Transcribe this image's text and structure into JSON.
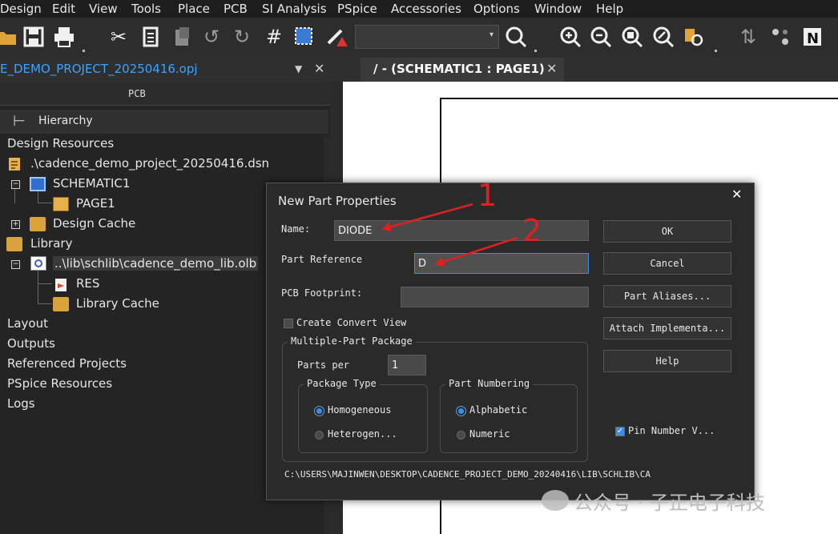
{
  "menu": [
    "Design",
    "Edit",
    "View",
    "Tools",
    "Place",
    "PCB",
    "SI Analysis",
    "PSpice",
    "Accessories",
    "Options",
    "Window",
    "Help"
  ],
  "toolbar": {
    "icons": [
      "folder-open-icon",
      "save-icon",
      "print-icon",
      "cut-icon",
      "copy-icon",
      "paste-icon",
      "undo-icon",
      "redo-icon",
      "grid-icon",
      "select-area-icon",
      "drc-icon",
      "search-icon",
      "zoom-in-icon",
      "zoom-out-icon",
      "zoom-area-icon",
      "zoom-all-icon",
      "find-parts-icon",
      "netlist-icon",
      "annotate-icon",
      "notes-icon"
    ],
    "search_value": ""
  },
  "project_tab": {
    "title": "E_DEMO_PROJECT_20250416.opj"
  },
  "schematic_tab": {
    "title": "/ - (SCHEMATIC1 : PAGE1)"
  },
  "panel": {
    "header": "PCB",
    "hierarchy_tab": "Hierarchy",
    "tree": [
      {
        "label": "Design Resources"
      },
      {
        "label": ".\\cadence_demo_project_20250416.dsn"
      },
      {
        "label": "SCHEMATIC1"
      },
      {
        "label": "PAGE1"
      },
      {
        "label": "Design Cache"
      },
      {
        "label": "Library"
      },
      {
        "label": "..\\lib\\schlib\\cadence_demo_lib.olb"
      },
      {
        "label": "RES"
      },
      {
        "label": "Library Cache"
      },
      {
        "label": "Layout"
      },
      {
        "label": "Outputs"
      },
      {
        "label": "Referenced Projects"
      },
      {
        "label": "PSpice Resources"
      },
      {
        "label": "Logs"
      }
    ]
  },
  "dialog": {
    "title": "New Part Properties",
    "name_label": "Name:",
    "name_value": "DIODE",
    "part_ref_label": "Part Reference",
    "part_ref_value": "D",
    "pcb_footprint_label": "PCB Footprint:",
    "pcb_footprint_value": "",
    "create_convert_label": "Create Convert View",
    "create_convert_checked": false,
    "multi_part_label": "Multiple-Part Package",
    "parts_per_label": "Parts per",
    "parts_per_value": "1",
    "package_type_label": "Package Type",
    "package_types": [
      "Homogeneous",
      "Heterogen..."
    ],
    "package_type_selected": "Homogeneous",
    "part_numbering_label": "Part Numbering",
    "part_numberings": [
      "Alphabetic",
      "Numeric"
    ],
    "part_numbering_selected": "Alphabetic",
    "buttons": [
      "OK",
      "Cancel",
      "Part Aliases...",
      "Attach Implementa...",
      "Help"
    ],
    "pin_number_label": "Pin Number V...",
    "pin_number_checked": true,
    "path": "C:\\USERS\\MAJINWEN\\DESKTOP\\CADENCE_PROJECT_DEMO_20240416\\LIB\\SCHLIB\\CA"
  },
  "annotations": [
    "1",
    "2"
  ],
  "watermark": "公众号 · 子正电子科技",
  "colors": {
    "accent": "#3a8ee6",
    "arrow": "#e02020",
    "link": "#3da3ff"
  }
}
